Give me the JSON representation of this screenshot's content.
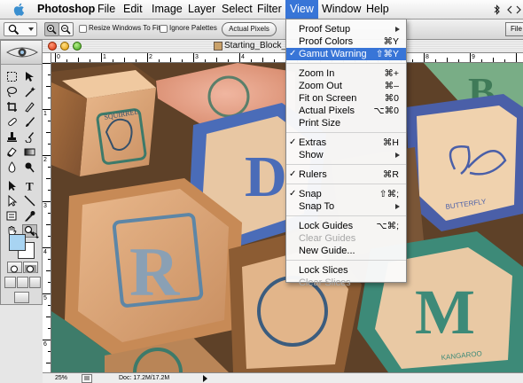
{
  "menubar": {
    "app_name": "Photoshop",
    "items": [
      "File",
      "Edit",
      "Image",
      "Layer",
      "Select",
      "Filter",
      "View",
      "Window",
      "Help"
    ],
    "active_item": "View",
    "right_glyphs": [
      "bluetooth-icon",
      "arrows-icon"
    ]
  },
  "options_bar": {
    "resize_windows_label": "Resize Windows To Fit",
    "ignore_palettes_label": "Ignore Palettes",
    "actual_pixels_label": "Actual Pixels",
    "file_button_label": "File"
  },
  "document": {
    "title": "Starting_Block_",
    "ruler_h_labels": [
      "0",
      "1",
      "2",
      "3",
      "4",
      "5",
      "6",
      "7",
      "8",
      "9"
    ],
    "ruler_v_labels": [
      "1",
      "2",
      "3",
      "4",
      "5",
      "6",
      "7"
    ],
    "zoom": "25%",
    "doc_info": "Doc: 17.2M/17.2M"
  },
  "blocks": {
    "squirrel_label": "SQUIRREL",
    "butterfly_label": "BUTTERFLY",
    "kangaroo_label": "KANGAROO",
    "letter_r": "R",
    "letter_m": "M",
    "letter_d": "D",
    "letter_b": "B"
  },
  "view_menu": {
    "items": [
      {
        "label": "Proof Setup",
        "shortcut": "",
        "submenu": true,
        "checked": false,
        "disabled": false
      },
      {
        "label": "Proof Colors",
        "shortcut": "⌘Y",
        "submenu": false,
        "checked": false,
        "disabled": false
      },
      {
        "label": "Gamut Warning",
        "shortcut": "⇧⌘Y",
        "submenu": false,
        "checked": true,
        "disabled": false,
        "highlighted": true
      },
      {
        "label": "Zoom In",
        "shortcut": "⌘+",
        "submenu": false,
        "checked": false,
        "disabled": false
      },
      {
        "label": "Zoom Out",
        "shortcut": "⌘–",
        "submenu": false,
        "checked": false,
        "disabled": false
      },
      {
        "label": "Fit on Screen",
        "shortcut": "⌘0",
        "submenu": false,
        "checked": false,
        "disabled": false
      },
      {
        "label": "Actual Pixels",
        "shortcut": "⌥⌘0",
        "submenu": false,
        "checked": false,
        "disabled": false
      },
      {
        "label": "Print Size",
        "shortcut": "",
        "submenu": false,
        "checked": false,
        "disabled": false
      },
      {
        "label": "Extras",
        "shortcut": "⌘H",
        "submenu": false,
        "checked": true,
        "disabled": false
      },
      {
        "label": "Show",
        "shortcut": "",
        "submenu": true,
        "checked": false,
        "disabled": false
      },
      {
        "label": "Rulers",
        "shortcut": "⌘R",
        "submenu": false,
        "checked": true,
        "disabled": false
      },
      {
        "label": "Snap",
        "shortcut": "⇧⌘;",
        "submenu": false,
        "checked": true,
        "disabled": false
      },
      {
        "label": "Snap To",
        "shortcut": "",
        "submenu": true,
        "checked": false,
        "disabled": false
      },
      {
        "label": "Lock Guides",
        "shortcut": "⌥⌘;",
        "submenu": false,
        "checked": false,
        "disabled": false
      },
      {
        "label": "Clear Guides",
        "shortcut": "",
        "submenu": false,
        "checked": false,
        "disabled": true
      },
      {
        "label": "New Guide...",
        "shortcut": "",
        "submenu": false,
        "checked": false,
        "disabled": false
      },
      {
        "label": "Lock Slices",
        "shortcut": "",
        "submenu": false,
        "checked": false,
        "disabled": false
      },
      {
        "label": "Clear Slices",
        "shortcut": "",
        "submenu": false,
        "checked": false,
        "disabled": true
      }
    ],
    "checkmark": "✓"
  },
  "colors": {
    "menu_highlight": "#3875d7",
    "foreground_swatch": "#a8d4f2",
    "background_swatch": "#ffffff"
  }
}
